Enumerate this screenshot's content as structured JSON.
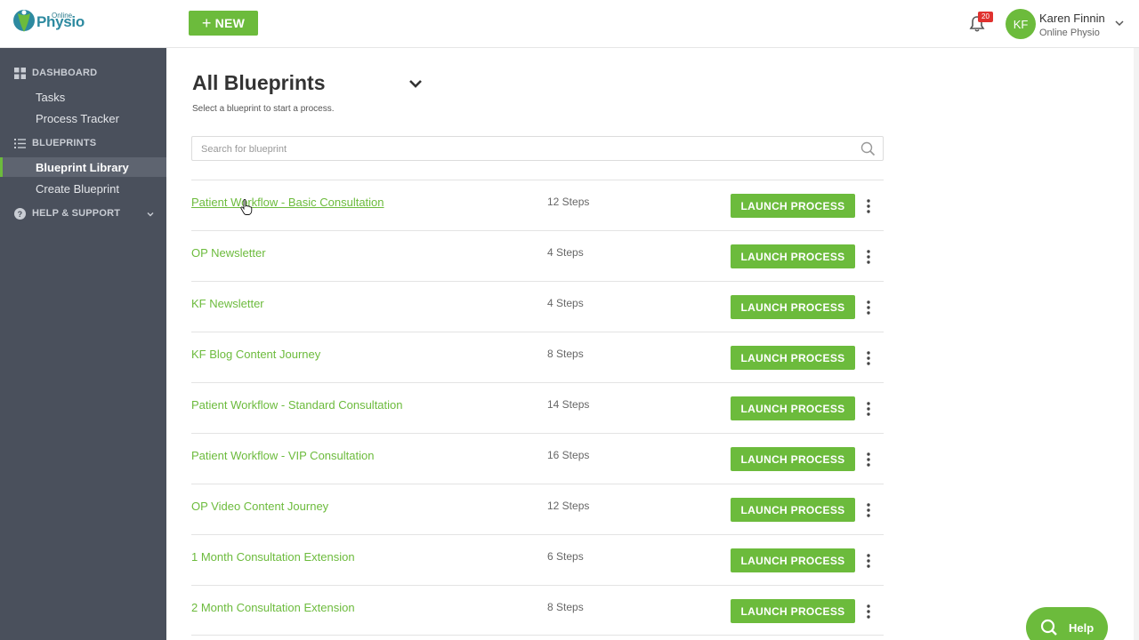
{
  "header": {
    "logo_small": "Online",
    "logo_big": "Physio",
    "new_button": "NEW",
    "notification_count": "20",
    "user_initials": "KF",
    "user_name": "Karen Finnin",
    "user_org": "Online Physio"
  },
  "sidebar": {
    "dashboard": "DASHBOARD",
    "tasks": "Tasks",
    "process_tracker": "Process Tracker",
    "blueprints": "BLUEPRINTS",
    "blueprint_library": "Blueprint Library",
    "create_blueprint": "Create Blueprint",
    "help_support": "HELP & SUPPORT"
  },
  "main": {
    "title": "All Blueprints",
    "subtitle": "Select a blueprint to start a process.",
    "search_placeholder": "Search for blueprint",
    "launch_label": "LAUNCH PROCESS",
    "rows": [
      {
        "name": "Patient Workflow - Basic Consultation",
        "steps": "12 Steps"
      },
      {
        "name": "OP Newsletter",
        "steps": "4 Steps"
      },
      {
        "name": "KF Newsletter",
        "steps": "4 Steps"
      },
      {
        "name": "KF Blog Content Journey",
        "steps": "8 Steps"
      },
      {
        "name": "Patient Workflow - Standard Consultation",
        "steps": "14 Steps"
      },
      {
        "name": "Patient Workflow - VIP Consultation",
        "steps": "16 Steps"
      },
      {
        "name": "OP Video Content Journey",
        "steps": "12 Steps"
      },
      {
        "name": "1 Month Consultation Extension",
        "steps": "6 Steps"
      },
      {
        "name": "2 Month Consultation Extension",
        "steps": "8 Steps"
      }
    ]
  },
  "help_button": "Help",
  "colors": {
    "accent": "#6cbb3c",
    "sidebar": "#4a505c",
    "badge": "#e0322f"
  }
}
